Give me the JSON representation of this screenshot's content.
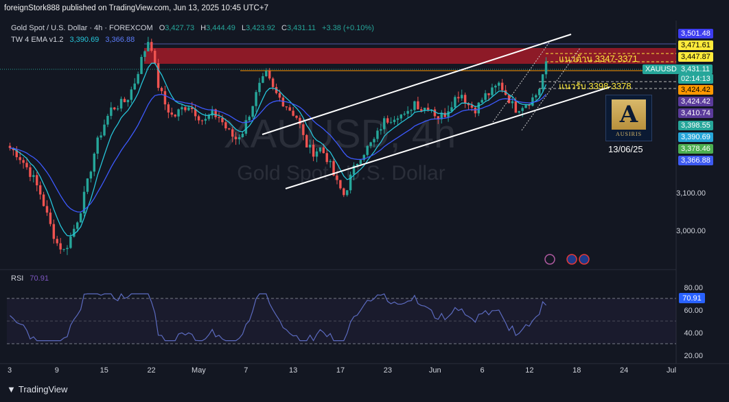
{
  "publish_line": "foreignStork888 published on TradingView.com, Jun 13, 2025 10:45 UTC+7",
  "symbol_header": {
    "name": "Gold Spot / U.S. Dollar · 4h · FOREXCOM",
    "open_label": "O",
    "open": "3,427.73",
    "high_label": "H",
    "high": "3,444.49",
    "low_label": "L",
    "low": "3,423.92",
    "close_label": "C",
    "close": "3,431.11",
    "change": "+3.38 (+0.10%)"
  },
  "ema_header": {
    "name": "TW 4 EMA v1.2",
    "v1": "3,390.69",
    "v2": "3,366.88"
  },
  "rsi_header": {
    "name": "RSI",
    "value": "70.91"
  },
  "watermark": {
    "symbol": "XAUUSD, 4h",
    "name": "Gold Spot / U.S. Dollar"
  },
  "annotations": {
    "resistance": "แนวต้าน 3347-3371",
    "support": "แนวรับ 3398-3378"
  },
  "ausiris": {
    "logo_letter": "A",
    "brand": "AUSIRIS",
    "date": "13/06/25"
  },
  "price_labels": [
    {
      "text": "3,501.48",
      "bg": "#3d3df0",
      "fg": "#ffffff"
    },
    {
      "text": "3,471.61",
      "bg": "#ffeb3b",
      "fg": "#000000"
    },
    {
      "text": "3,447.87",
      "bg": "#ffeb3b",
      "fg": "#000000"
    },
    {
      "text": "XAUUSD",
      "bg": "#26a69a",
      "fg": "#ffffff"
    },
    {
      "text": "3,431.11",
      "bg": "#26a69a",
      "fg": "#ffffff"
    },
    {
      "text": "02:14:13",
      "bg": "#26a69a",
      "fg": "#ffffff"
    },
    {
      "text": "3,424.42",
      "bg": "#ff9800",
      "fg": "#000000"
    },
    {
      "text": "3,424.42",
      "bg": "#5b3b9b",
      "fg": "#ffffff"
    },
    {
      "text": "3,410.74",
      "bg": "#5b3b9b",
      "fg": "#ffffff"
    },
    {
      "text": "3,398.55",
      "bg": "#26a69a",
      "fg": "#ffffff"
    },
    {
      "text": "3,390.69",
      "bg": "#26a6d9",
      "fg": "#ffffff"
    },
    {
      "text": "3,378.46",
      "bg": "#4caf50",
      "fg": "#ffffff"
    },
    {
      "text": "3,366.88",
      "bg": "#3d5af1",
      "fg": "#ffffff"
    }
  ],
  "price_ticks": [
    "3,100.00",
    "3,000.00"
  ],
  "rsi_ticks": [
    "80.00",
    "60.00",
    "40.00",
    "20.00"
  ],
  "rsi_value_label": "70.91",
  "time_ticks": [
    "3",
    "9",
    "15",
    "22",
    "May",
    "7",
    "13",
    "17",
    "23",
    "Jun",
    "6",
    "12",
    "18",
    "24",
    "Jul"
  ],
  "footer_brand": "TradingView",
  "colors": {
    "up": "#26a69a",
    "down": "#ef5350",
    "ema_fast": "#26c6da",
    "ema_slow": "#3d5afe",
    "rsi_line": "#5c6bc0",
    "resistance_zone": "#b71c2a"
  },
  "chart_data": {
    "type": "candlestick",
    "title": "Gold Spot / U.S. Dollar · 4h · FOREXCOM",
    "y_range": [
      2960,
      3510
    ],
    "x_ticks": [
      "3",
      "9",
      "15",
      "22",
      "May",
      "7",
      "13",
      "17",
      "23",
      "Jun",
      "6",
      "12",
      "18",
      "24",
      "Jul"
    ],
    "close_path": [
      3230,
      3215,
      3190,
      3160,
      3120,
      3060,
      3010,
      2990,
      3030,
      3080,
      3150,
      3230,
      3280,
      3320,
      3330,
      3340,
      3380,
      3440,
      3490,
      3380,
      3330,
      3300,
      3320,
      3330,
      3310,
      3290,
      3310,
      3300,
      3270,
      3250,
      3270,
      3320,
      3370,
      3400,
      3360,
      3340,
      3320,
      3300,
      3240,
      3220,
      3230,
      3200,
      3150,
      3120,
      3170,
      3210,
      3230,
      3250,
      3290,
      3300,
      3310,
      3300,
      3340,
      3320,
      3330,
      3300,
      3310,
      3340,
      3360,
      3330,
      3320,
      3350,
      3360,
      3380,
      3350,
      3320,
      3330,
      3340,
      3360,
      3431
    ],
    "rsi_range": [
      20,
      80
    ],
    "rsi_last": 70.91
  }
}
